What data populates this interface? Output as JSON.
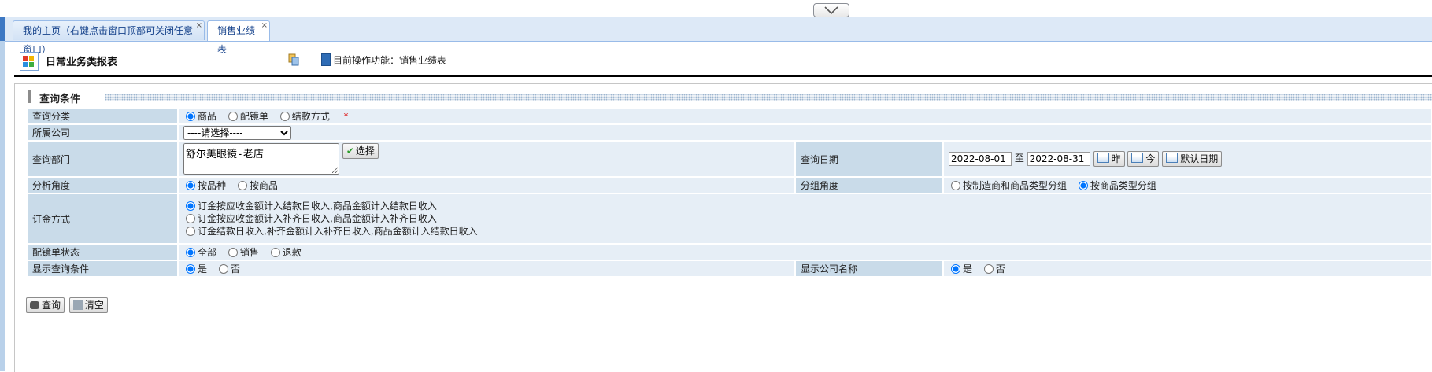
{
  "tabs": [
    {
      "label": "我的主页（右键点击窗口顶部可关闭任意窗口）",
      "active": false
    },
    {
      "label": "销售业绩表",
      "active": true
    }
  ],
  "tab_close_glyph": "×",
  "header": {
    "title": "日常业务类报表",
    "function_label": "目前操作功能：销售业绩表"
  },
  "query": {
    "section_title": "查询条件",
    "category": {
      "label": "查询分类",
      "options": [
        "商品",
        "配镜单",
        "结款方式"
      ],
      "selected": "商品",
      "required_mark": "*"
    },
    "company": {
      "label": "所属公司",
      "selected": "----请选择----"
    },
    "department": {
      "label": "查询部门",
      "value": "舒尔美眼镜-老店",
      "select_button": "选择"
    },
    "date": {
      "label": "查询日期",
      "from": "2022-08-01",
      "to_label": "至",
      "to": "2022-08-31",
      "yesterday": "昨",
      "today": "今",
      "default": "默认日期"
    },
    "analysis": {
      "label": "分析角度",
      "options": [
        "按品种",
        "按商品"
      ],
      "selected": "按品种"
    },
    "grouping": {
      "label": "分组角度",
      "options": [
        "按制造商和商品类型分组",
        "按商品类型分组"
      ],
      "selected": "按商品类型分组"
    },
    "deposit": {
      "label": "订金方式",
      "options": [
        "订金按应收金额计入结款日收入,商品金额计入结款日收入",
        "订金按应收金额计入补齐日收入,商品金额计入补齐日收入",
        "订金结款日收入,补齐金额计入补齐日收入,商品金额计入结款日收入"
      ],
      "selected": 0
    },
    "status": {
      "label": "配镜单状态",
      "options": [
        "全部",
        "销售",
        "退款"
      ],
      "selected": "全部"
    },
    "show_conditions": {
      "label": "显示查询条件",
      "options": [
        "是",
        "否"
      ],
      "selected": "是"
    },
    "show_company": {
      "label": "显示公司名称",
      "options": [
        "是",
        "否"
      ],
      "selected": "是"
    },
    "buttons": {
      "search": "查询",
      "clear": "清空"
    }
  }
}
